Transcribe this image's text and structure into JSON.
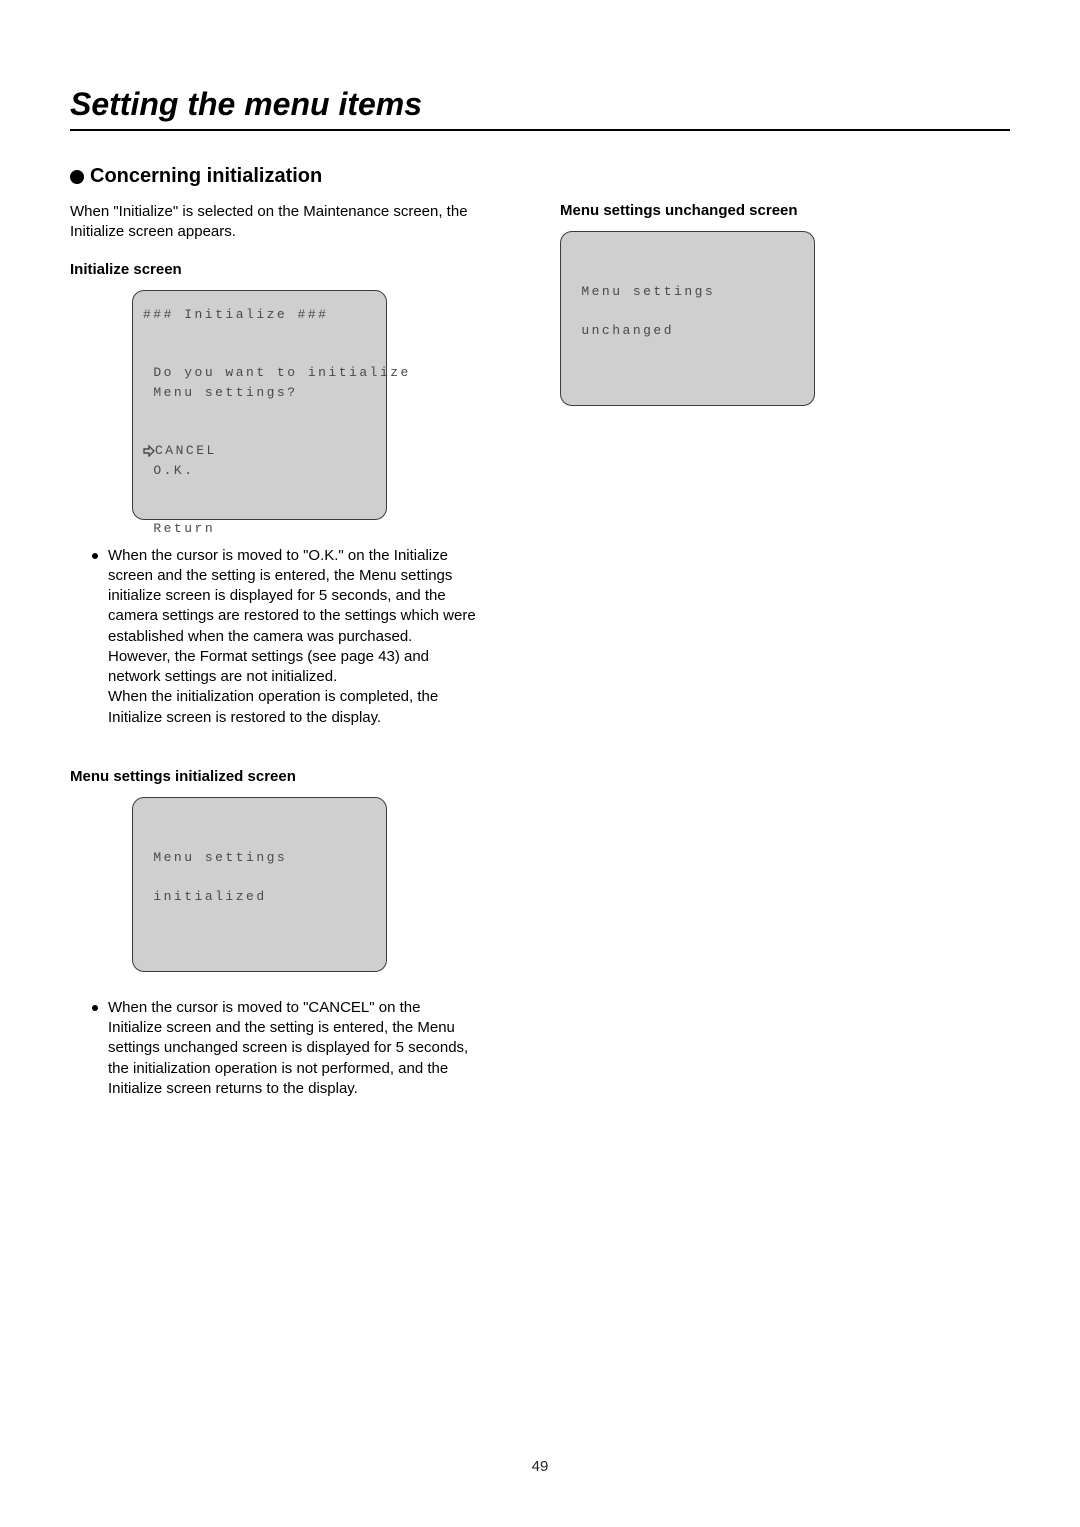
{
  "page": {
    "title": "Setting the menu items",
    "section_heading": "Concerning initialization",
    "page_number": "49"
  },
  "left": {
    "intro": "When \"Initialize\" is selected on the Maintenance screen, the Initialize screen appears.",
    "screen1_label": "Initialize screen",
    "screen1": {
      "line1": "### Initialize ###",
      "line2": "Do you want to initialize",
      "line3": "Menu settings?",
      "cancel": "CANCEL",
      "ok": "O.K.",
      "return": "Return"
    },
    "para1": "When the cursor is moved to \"O.K.\" on the Initialize screen and the setting is entered, the Menu settings initialize screen is displayed for 5 seconds, and the camera settings are restored to the settings which were established when the camera was purchased. However, the Format settings (see page 43) and network settings are not initialized.\nWhen the initialization operation is completed, the Initialize screen is restored to the display.",
    "screen2_label": "Menu settings initialized screen",
    "screen2": {
      "line1": "Menu settings",
      "line2": "initialized"
    },
    "para2": "When the cursor is moved to \"CANCEL\" on the Initialize screen and the setting is entered, the Menu settings unchanged screen is displayed for 5 seconds, the initialization operation is not performed, and the Initialize screen returns to the display."
  },
  "right": {
    "screen3_label": "Menu settings unchanged screen",
    "screen3": {
      "line1": "Menu settings",
      "line2": "unchanged"
    }
  }
}
